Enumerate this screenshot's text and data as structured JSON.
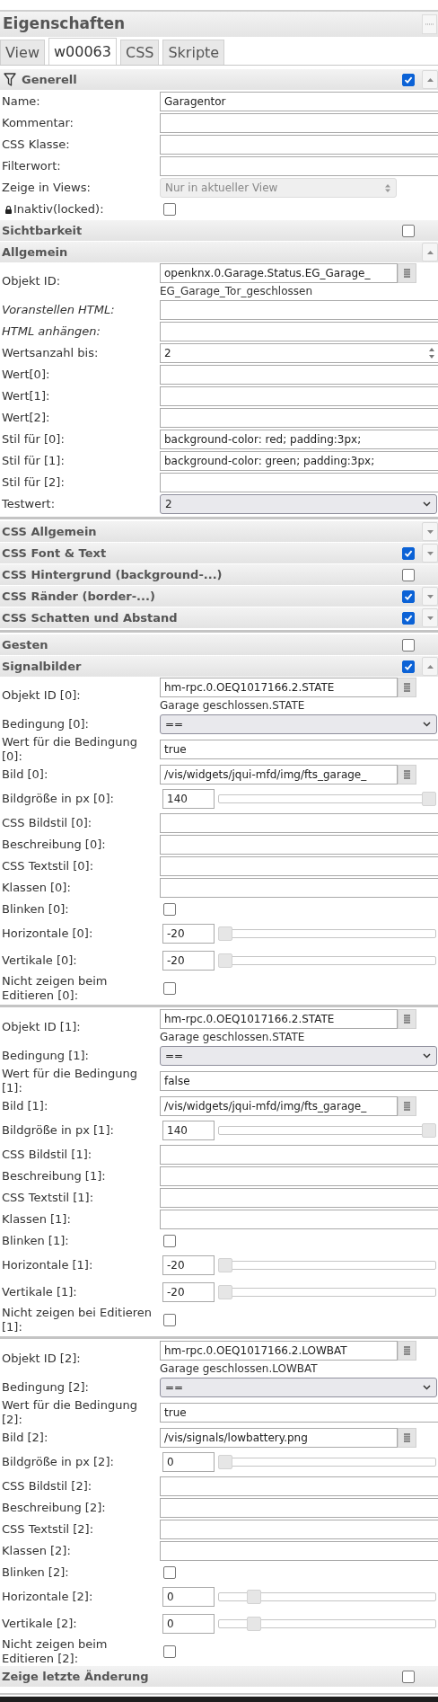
{
  "panel": {
    "title": "Eigenschaften"
  },
  "tabs": [
    {
      "label": "View",
      "selected": false
    },
    {
      "label": "w00063",
      "selected": true
    },
    {
      "label": "CSS",
      "selected": false
    },
    {
      "label": "Skripte",
      "selected": false
    }
  ],
  "sections": [
    {
      "kind": "group",
      "title": "Generell",
      "filter": true,
      "checked": true,
      "expanded": true,
      "rows": [
        {
          "kind": "text",
          "label": "Name:",
          "value": "Garagentor"
        },
        {
          "kind": "text",
          "label": "Kommentar:"
        },
        {
          "kind": "text",
          "label": "CSS Klasse:"
        },
        {
          "kind": "text",
          "label": "Filterwort:"
        },
        {
          "kind": "select",
          "label": "Zeige in Views:",
          "value": "Nur in aktueller View",
          "disabled": true
        },
        {
          "kind": "locked_checkbox",
          "label": "Inaktiv(locked):",
          "checked": false
        }
      ]
    },
    {
      "kind": "group",
      "title": "Sichtbarkeit",
      "checked": false
    },
    {
      "kind": "group",
      "title": "Allgemein",
      "expanded": true,
      "rows": [
        {
          "kind": "picker",
          "label": "Objekt ID:",
          "value": "openknx.0.Garage.Status.EG_Garage_",
          "caption": "EG_Garage_Tor_geschlossen"
        },
        {
          "kind": "text",
          "label": "Voranstellen HTML:",
          "italic": true
        },
        {
          "kind": "text",
          "label": "HTML anhängen:",
          "italic": true
        },
        {
          "kind": "number",
          "label": "Wertsanzahl bis:",
          "value": "2"
        },
        {
          "kind": "text",
          "label": "Wert[0]:"
        },
        {
          "kind": "text",
          "label": "Wert[1]:"
        },
        {
          "kind": "text",
          "label": "Wert[2]:"
        },
        {
          "kind": "text",
          "label": "Stil für [0]:",
          "value": "background-color: red; padding:3px;"
        },
        {
          "kind": "text",
          "label": "Stil für [1]:",
          "value": "background-color: green; padding:3px;"
        },
        {
          "kind": "text",
          "label": "Stil für [2]:"
        },
        {
          "kind": "select",
          "label": "Testwert:",
          "value": "2",
          "disabled": false
        }
      ]
    },
    {
      "kind": "divider"
    },
    {
      "kind": "group",
      "title": "CSS Allgemein",
      "expanded": false
    },
    {
      "kind": "group",
      "title": "CSS Font & Text",
      "checked": true,
      "expanded": false
    },
    {
      "kind": "group",
      "title": "CSS Hintergrund (background-...)",
      "checked": false
    },
    {
      "kind": "group",
      "title": "CSS Ränder (border-...)",
      "checked": true,
      "expanded": false
    },
    {
      "kind": "group",
      "title": "CSS Schatten und Abstand",
      "checked": true,
      "expanded": false
    },
    {
      "kind": "divider"
    },
    {
      "kind": "group",
      "title": "Gesten",
      "checked": false
    },
    {
      "kind": "group",
      "title": "Signalbilder",
      "checked": true,
      "expanded": true,
      "rows": [
        {
          "kind": "picker",
          "label": "Objekt ID [0]:",
          "value": "hm-rpc.0.OEQ1017166.2.STATE",
          "caption": "Garage geschlossen.STATE"
        },
        {
          "kind": "select",
          "label": "Bedingung [0]:",
          "value": "==",
          "disabled": false
        },
        {
          "kind": "text",
          "label": "Wert für die Bedingung [0]:",
          "value": "true"
        },
        {
          "kind": "picker",
          "label": "Bild [0]:",
          "value": "/vis/widgets/jqui-mfd/img/fts_garage_"
        },
        {
          "kind": "slider",
          "label": "Bildgröße in px [0]:",
          "value": "140",
          "level": 1
        },
        {
          "kind": "text",
          "label": "CSS Bildstil [0]:"
        },
        {
          "kind": "text",
          "label": "Beschreibung [0]:"
        },
        {
          "kind": "text",
          "label": "CSS Textstil [0]:"
        },
        {
          "kind": "text",
          "label": "Klassen [0]:"
        },
        {
          "kind": "checkbox",
          "label": "Blinken [0]:",
          "checked": false
        },
        {
          "kind": "slider",
          "label": "Horizontale [0]:",
          "value": "-20",
          "level": 0
        },
        {
          "kind": "slider",
          "label": "Vertikale [0]:",
          "value": "-20",
          "level": 0
        },
        {
          "kind": "checkbox",
          "label": "Nicht zeigen beim Editieren [0]:",
          "checked": false
        },
        {
          "kind": "separator"
        },
        {
          "kind": "picker",
          "label": "Objekt ID [1]:",
          "value": "hm-rpc.0.OEQ1017166.2.STATE",
          "caption": "Garage geschlossen.STATE"
        },
        {
          "kind": "select",
          "label": "Bedingung [1]:",
          "value": "==",
          "disabled": false
        },
        {
          "kind": "text",
          "label": "Wert für die Bedingung [1]:",
          "value": "false"
        },
        {
          "kind": "picker",
          "label": "Bild [1]:",
          "value": "/vis/widgets/jqui-mfd/img/fts_garage_"
        },
        {
          "kind": "slider",
          "label": "Bildgröße in px [1]:",
          "value": "140",
          "level": 1
        },
        {
          "kind": "text",
          "label": "CSS Bildstil [1]:"
        },
        {
          "kind": "text",
          "label": "Beschreibung [1]:"
        },
        {
          "kind": "text",
          "label": "CSS Textstil [1]:"
        },
        {
          "kind": "text",
          "label": "Klassen [1]:"
        },
        {
          "kind": "checkbox",
          "label": "Blinken [1]:",
          "checked": false
        },
        {
          "kind": "slider",
          "label": "Horizontale [1]:",
          "value": "-20",
          "level": 0
        },
        {
          "kind": "slider",
          "label": "Vertikale [1]:",
          "value": "-20",
          "level": 0
        },
        {
          "kind": "checkbox",
          "label": "Nicht zeigen bei Editieren [1]:",
          "checked": false
        },
        {
          "kind": "separator"
        },
        {
          "kind": "picker",
          "label": "Objekt ID [2]:",
          "value": "hm-rpc.0.OEQ1017166.2.LOWBAT",
          "caption": "Garage geschlossen.LOWBAT"
        },
        {
          "kind": "select",
          "label": "Bedingung [2]:",
          "value": "==",
          "disabled": false
        },
        {
          "kind": "text",
          "label": "Wert für die Bedingung [2]:",
          "value": "true"
        },
        {
          "kind": "picker",
          "label": "Bild [2]:",
          "value": "/vis/signals/lowbattery.png"
        },
        {
          "kind": "slider",
          "label": "Bildgröße in px [2]:",
          "value": "0",
          "level": 0
        },
        {
          "kind": "text",
          "label": "CSS Bildstil [2]:"
        },
        {
          "kind": "text",
          "label": "Beschreibung [2]:"
        },
        {
          "kind": "text",
          "label": "CSS Textstil [2]:"
        },
        {
          "kind": "text",
          "label": "Klassen [2]:"
        },
        {
          "kind": "checkbox",
          "label": "Blinken [2]:",
          "checked": false
        },
        {
          "kind": "slider",
          "label": "Horizontale [2]:",
          "value": "0",
          "level": 0.14
        },
        {
          "kind": "slider",
          "label": "Vertikale [2]:",
          "value": "0",
          "level": 0.14
        },
        {
          "kind": "checkbox",
          "label": "Nicht zeigen beim Editieren [2]:",
          "checked": false
        }
      ]
    },
    {
      "kind": "group",
      "title": "Zeige letzte Änderung",
      "checked": false
    }
  ]
}
